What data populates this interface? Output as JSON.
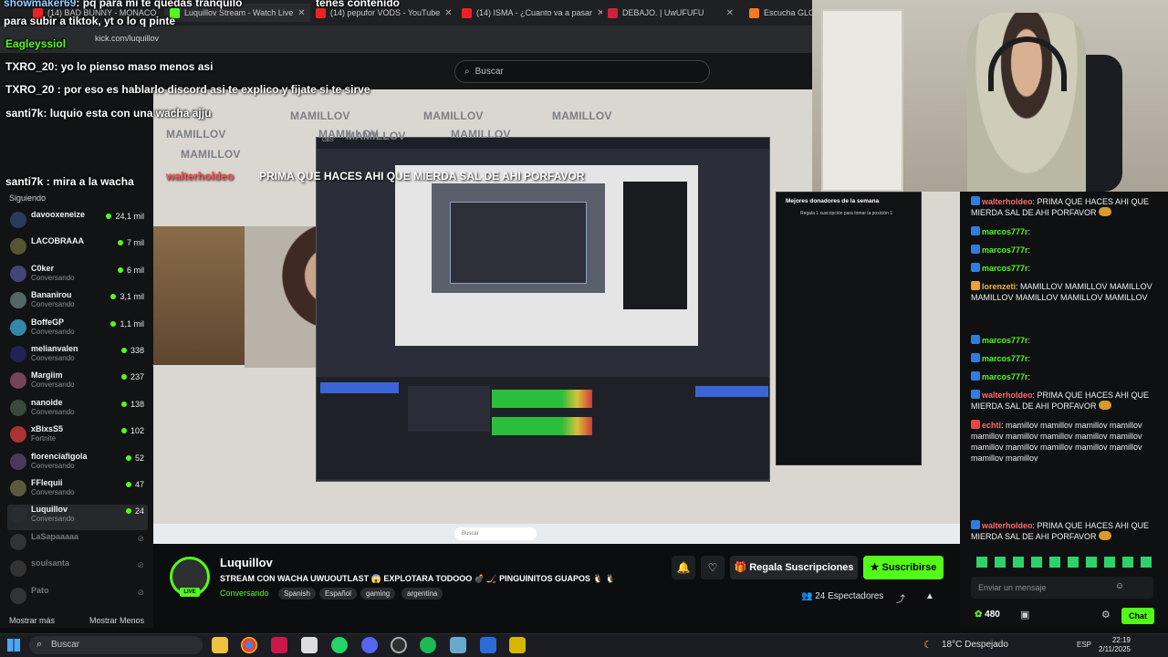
{
  "browser": {
    "tabs": [
      {
        "label": "(14) BAD BUNNY - MONACO"
      },
      {
        "label": "Luquillov Stream - Watch Live"
      },
      {
        "label": "(14) pepufor VODS - YouTube"
      },
      {
        "label": "(14) ISMA - ¿Cuanto va a pasar"
      },
      {
        "label": "DEBAJO. | UwUFUFU"
      },
      {
        "label": "Escucha GLOPI"
      }
    ],
    "url": "kick.com/luquillov"
  },
  "kick": {
    "search_placeholder": "Buscar"
  },
  "sidebar": {
    "following_label": "Siguiendo",
    "items": [
      {
        "name": "davooxeneize",
        "sub": "",
        "viewers": "24,1 mil"
      },
      {
        "name": "LACOBRAAA",
        "sub": "",
        "viewers": "7 mil"
      },
      {
        "name": "C0ker",
        "sub": "Conversando",
        "viewers": "6 mil"
      },
      {
        "name": "Bananirou",
        "sub": "Conversando",
        "viewers": "3,1 mil"
      },
      {
        "name": "BoffeGP",
        "sub": "Conversando",
        "viewers": "1,1 mil"
      },
      {
        "name": "melianvalen",
        "sub": "Conversando",
        "viewers": "338"
      },
      {
        "name": "Margiim",
        "sub": "Conversando",
        "viewers": "237"
      },
      {
        "name": "nanoide",
        "sub": "Conversando",
        "viewers": "138"
      },
      {
        "name": "xBixsS5",
        "sub": "Fortnite",
        "viewers": "102"
      },
      {
        "name": "florenciafigola",
        "sub": "Conversando",
        "viewers": "52"
      },
      {
        "name": "FFlequii",
        "sub": "Conversando",
        "viewers": "47"
      },
      {
        "name": "Luquillov",
        "sub": "Conversando",
        "viewers": "24"
      },
      {
        "name": "LaSapaaaaa",
        "sub": "",
        "viewers": ""
      },
      {
        "name": "soulsanta",
        "sub": "",
        "viewers": ""
      },
      {
        "name": "Pato",
        "sub": "",
        "viewers": ""
      }
    ],
    "show_more": "Mostrar más",
    "show_less": "Mostrar Menos"
  },
  "overlay_chat": [
    {
      "user": "showmaker69",
      "text": "pq para mi te quedas tranquilo"
    },
    {
      "user": "",
      "text": "tenes contenido"
    },
    {
      "user": "",
      "text": "para subir a tiktok, yt o lo q pinte"
    },
    {
      "user": "Eagleyssiol",
      "text": ""
    },
    {
      "user": "TXRO_20",
      "text": "yo lo pienso maso menos asi"
    },
    {
      "user": "TXRO_20",
      "text": "por eso es hablarlo discord asi te explico y fijate si te sirve"
    },
    {
      "user": "santi7k",
      "text": "luquio esta con una wacha ajju"
    },
    {
      "user": "santi7k",
      "text": "mira a la wacha"
    }
  ],
  "stream_overlay": {
    "name": "walterholdeo",
    "text": "PRIMA QUE HACES AHI QUE MIERDA SAL DE AHI PORFAVOR",
    "watermark": "MAMILLOV",
    "leaderboard_title": "Mejores donadores de la semana",
    "leaderboard_sub": "Regala 1 suscripción para tomar la posición 1"
  },
  "chat": {
    "messages": [
      {
        "user": "walterholdeo",
        "color": "r",
        "text": "PRIMA QUE HACES AHI QUE MIERDA SAL DE AHI PORFAVOR"
      },
      {
        "user": "marcos777r",
        "color": "g",
        "text": ""
      },
      {
        "user": "marcos777r",
        "color": "g",
        "text": ""
      },
      {
        "user": "marcos777r",
        "color": "g",
        "text": ""
      },
      {
        "user": "lorenzeti",
        "color": "o",
        "text": "MAMILLOV MAMILLOV MAMILLOV MAMILLOV MAMILLOV MAMILLOV MAMILLOV"
      },
      {
        "user": "marcos777r",
        "color": "g",
        "text": ""
      },
      {
        "user": "marcos777r",
        "color": "g",
        "text": ""
      },
      {
        "user": "marcos777r",
        "color": "g",
        "text": ""
      },
      {
        "user": "walterholdeo",
        "color": "r",
        "text": "PRIMA QUE HACES AHI QUE MIERDA SAL DE AHI PORFAVOR"
      },
      {
        "user": "echti",
        "color": "r",
        "text": "mamillov mamillov mamillov mamillov mamillov mamillov mamillov mamillov mamillov mamillov mamillov mamillov mamillov mamillov mamillov mamillov"
      },
      {
        "user": "walterholdeo",
        "color": "r",
        "text": "PRIMA QUE HACES AHI QUE MIERDA SAL DE AHI PORFAVOR"
      }
    ],
    "input_placeholder": "Enviar un mensaje",
    "points": "480",
    "send_label": "Chat"
  },
  "stream": {
    "streamer": "Luquillov",
    "live_label": "LIVE",
    "title": "STREAM CON WACHA UWUOUTLAST 😱 EXPLOTARA TODOOO 💣 🏒 PINGUINITOS GUAPOS 🐧 🐧",
    "category": "Conversando",
    "tags": [
      "Spanish",
      "Español",
      "gaming",
      "argentina"
    ],
    "gift_label": "Regala Suscripciones",
    "subscribe_label": "Suscribirse",
    "viewers": "24 Espectadores"
  },
  "taskbar": {
    "search_placeholder": "Buscar",
    "weather": "18°C Despejado",
    "lang": "ESP",
    "time": "22:19",
    "date": "2/11/2025"
  },
  "colors": {
    "kick_green": "#53fc18",
    "background": "#0b0e0f"
  }
}
